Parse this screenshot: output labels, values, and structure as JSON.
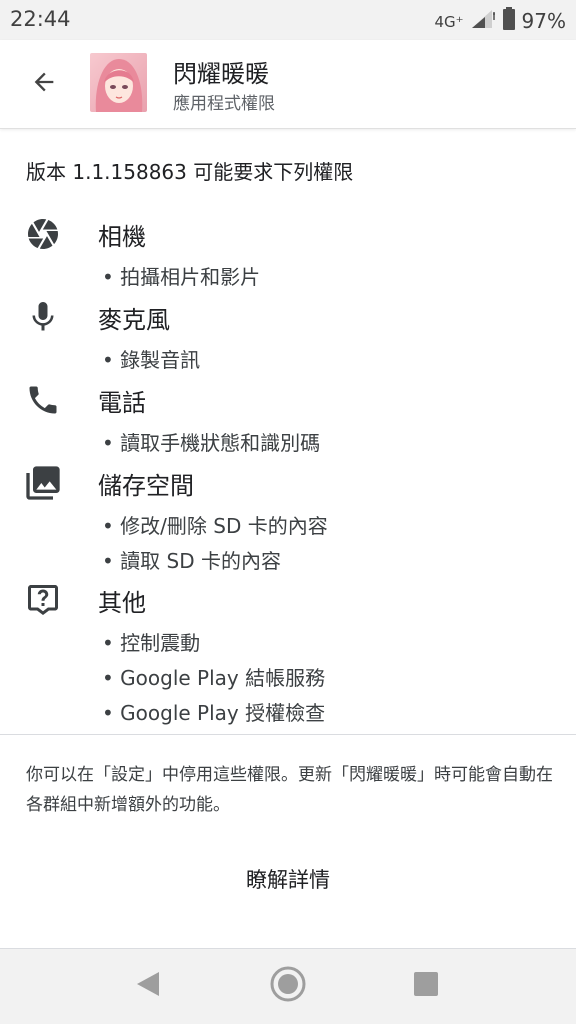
{
  "status_bar": {
    "time": "22:44",
    "network": "4G⁺",
    "battery": "97%"
  },
  "app_bar": {
    "app_name": "閃耀暖暖",
    "subtitle": "應用程式權限"
  },
  "version_line": "版本 1.1.158863 可能要求下列權限",
  "permission_groups": [
    {
      "icon": "camera-icon",
      "title": "相機",
      "items": [
        "• 拍攝相片和影片"
      ]
    },
    {
      "icon": "microphone-icon",
      "title": "麥克風",
      "items": [
        "• 錄製音訊"
      ]
    },
    {
      "icon": "phone-icon",
      "title": "電話",
      "items": [
        "• 讀取手機狀態和識別碼"
      ]
    },
    {
      "icon": "photo-library-icon",
      "title": "儲存空間",
      "items": [
        "• 修改/刪除 SD 卡的內容",
        "• 讀取 SD 卡的內容"
      ]
    },
    {
      "icon": "help-icon",
      "title": "其他",
      "items": [
        "• 控制震動",
        "• Google Play 結帳服務",
        "• Google Play 授權檢查"
      ]
    }
  ],
  "footnote": "你可以在「設定」中停用這些權限。更新「閃耀暖暖」時可能會自動在各群組中新增額外的功能。",
  "learn_more": "瞭解詳情",
  "colors": {
    "text_primary": "#202124",
    "text_secondary": "#5f6368",
    "icon": "#3c4043",
    "bars": "#f2f2f2"
  }
}
